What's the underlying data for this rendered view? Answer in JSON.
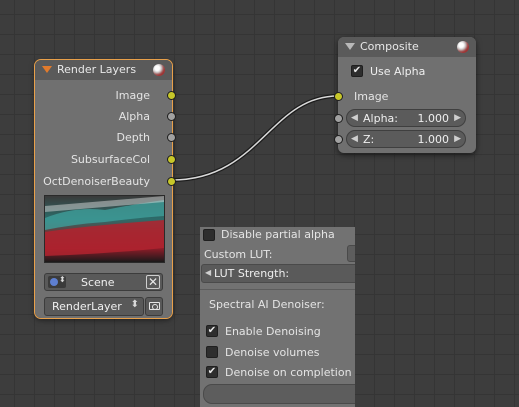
{
  "render_layers_node": {
    "title": "Render Layers",
    "outputs": [
      {
        "label": "Image",
        "socket": "yellow"
      },
      {
        "label": "Alpha",
        "socket": "gray"
      },
      {
        "label": "Depth",
        "socket": "gray"
      },
      {
        "label": "SubsurfaceCol",
        "socket": "yellow"
      },
      {
        "label": "OctDenoiserBeauty",
        "socket": "yellow"
      }
    ],
    "scene": "Scene",
    "render_layer": "RenderLayer"
  },
  "composite_node": {
    "title": "Composite",
    "use_alpha_label": "Use Alpha",
    "use_alpha_checked": true,
    "image_label": "Image",
    "alpha_label": "Alpha:",
    "alpha_value": "1.000",
    "z_label": "Z:",
    "z_value": "1.000"
  },
  "properties_panel": {
    "disable_partial_alpha": "Disable partial alpha",
    "custom_lut": "Custom LUT:",
    "lut_strength": "LUT Strength:",
    "spectral_denoiser": "Spectral AI Denoiser:",
    "enable_denoising": "Enable Denoising",
    "enable_denoising_checked": true,
    "denoise_volumes": "Denoise volumes",
    "denoise_volumes_checked": false,
    "denoise_on_completion": "Denoise on completion",
    "denoise_on_completion_checked": true
  },
  "colors": {
    "socket_image": "#c7c729",
    "socket_value": "#a1a1a1",
    "active_outline": "#e8a04a"
  }
}
